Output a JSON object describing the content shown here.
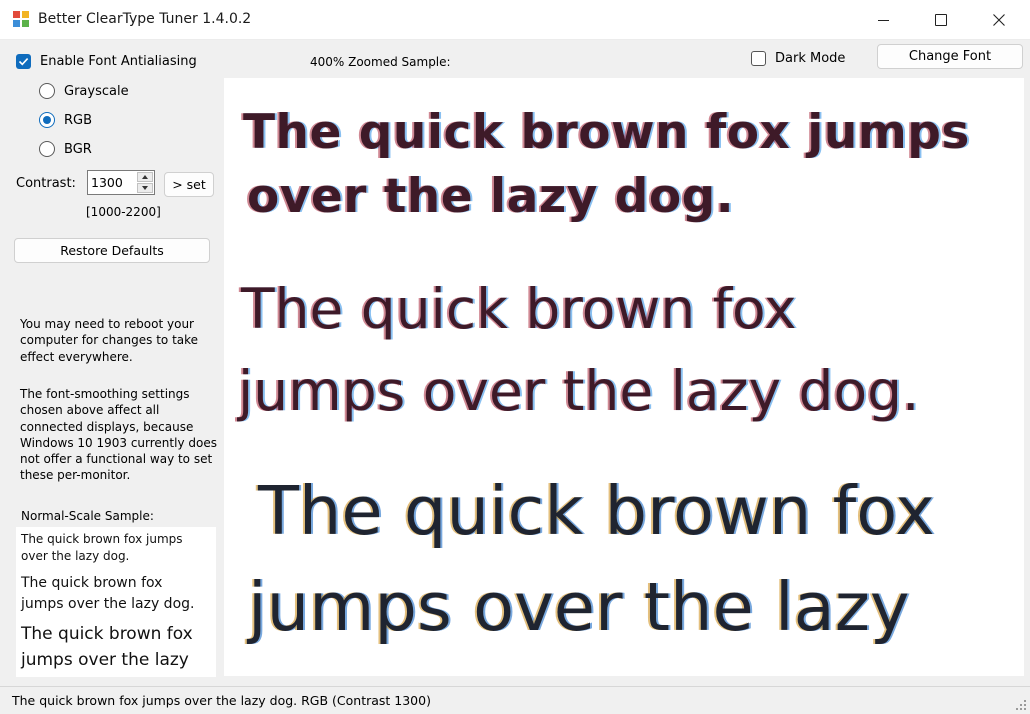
{
  "window": {
    "title": "Better ClearType Tuner 1.4.0.2"
  },
  "options": {
    "enable_antialiasing_label": "Enable Font Antialiasing",
    "enable_antialiasing_checked": true,
    "radios": [
      {
        "label": "Grayscale",
        "selected": false
      },
      {
        "label": "RGB",
        "selected": true
      },
      {
        "label": "BGR",
        "selected": false
      }
    ],
    "contrast_label": "Contrast:",
    "contrast_value": "1300",
    "set_label": "> set",
    "range_label": "[1000-2200]",
    "restore_label": "Restore Defaults"
  },
  "notes": {
    "reboot": "You may need to reboot your computer for changes to take effect everywhere.",
    "monitors": "The font-smoothing settings chosen above affect all connected displays, because Windows 10 1903 currently does not offer a functional way to set these per-monitor."
  },
  "normal_sample": {
    "label": "Normal-Scale Sample:",
    "lines": [
      [
        "The quick brown fox jumps",
        "over the lazy dog."
      ],
      [
        "The quick brown fox",
        "jumps over the lazy dog."
      ],
      [
        "The quick brown fox",
        "jumps over the lazy"
      ]
    ]
  },
  "zoom": {
    "label": "400% Zoomed Sample:",
    "dark_mode_label": "Dark Mode",
    "dark_mode_checked": false,
    "change_font_label": "Change Font",
    "lines": [
      "The quick brown fox jumps",
      "over the lazy dog.",
      "The quick brown fox",
      "jumps over the lazy dog.",
      "The quick brown fox",
      "jumps over the lazy"
    ]
  },
  "status": {
    "text": "The quick brown fox jumps over the lazy dog. RGB (Contrast 1300)"
  },
  "colors": {
    "accent": "#0f6cbd",
    "window_bg": "#f0f0f0",
    "panel_bg": "#ffffff"
  }
}
